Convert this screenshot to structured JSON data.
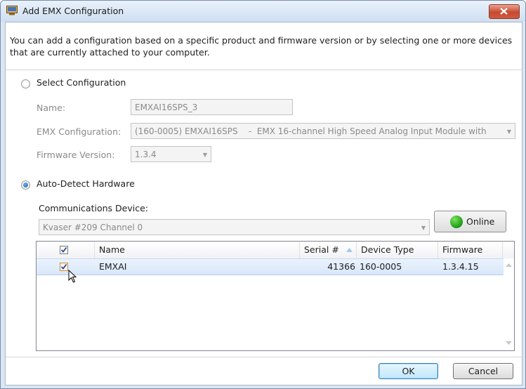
{
  "window": {
    "title": "Add EMX Configuration",
    "description": "You can add a configuration based on a specific product and firmware version or by selecting one or more devices that are currently attached to your computer."
  },
  "select_config": {
    "radio_label": "Select Configuration",
    "selected": false,
    "name_label": "Name:",
    "name_value": "EMXAI16SPS_3",
    "emx_label": "EMX Configuration:",
    "emx_value": "(160-0005) EMXAI16SPS    -  EMX 16-channel High Speed Analog Input Module with",
    "firmware_label": "Firmware Version:",
    "firmware_value": "1.3.4"
  },
  "auto_detect": {
    "radio_label": "Auto-Detect Hardware",
    "selected": true,
    "comm_label": "Communications Device:",
    "comm_value": "Kvaser #209 Channel 0",
    "online_label": "Online"
  },
  "grid": {
    "columns": [
      "Name",
      "Serial #",
      "Device Type",
      "Firmware"
    ],
    "header_checked": true,
    "rows": [
      {
        "checked": true,
        "name": "EMXAI",
        "serial": "41366",
        "device_type": "160-0005",
        "firmware": "1.3.4.15"
      }
    ]
  },
  "buttons": {
    "ok": "OK",
    "cancel": "Cancel"
  },
  "colors": {
    "online": "#2db523",
    "accent": "#3c7fb1",
    "selection": "#d8e7f9"
  }
}
